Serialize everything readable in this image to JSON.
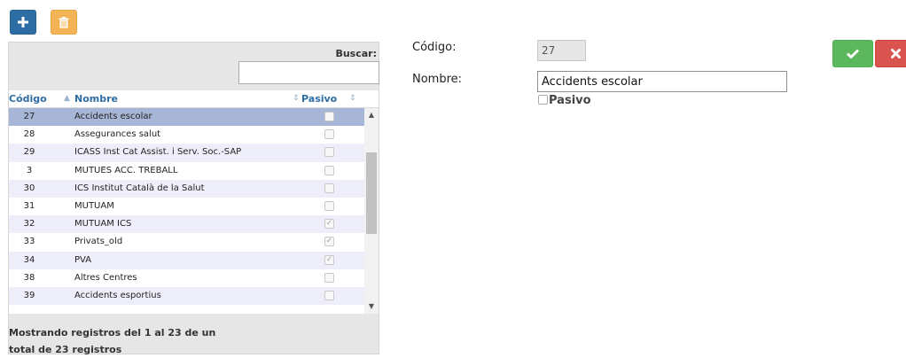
{
  "toolbar": {
    "add_icon": "plus-icon",
    "delete_icon": "trash-icon",
    "add_color": "#2e6da4",
    "delete_color": "#f4b455"
  },
  "grid": {
    "search_label": "Buscar:",
    "search_value": "",
    "columns": [
      "Código",
      "Nombre",
      "Pasivo"
    ],
    "rows": [
      {
        "code": "27",
        "name": "Accidents escolar",
        "pasivo": false,
        "selected": true
      },
      {
        "code": "28",
        "name": "Assegurances salut",
        "pasivo": false
      },
      {
        "code": "29",
        "name": "ICASS Inst Cat Assist. i Serv. Soc.-SAP",
        "pasivo": false
      },
      {
        "code": "3",
        "name": "MUTUES ACC. TREBALL",
        "pasivo": false
      },
      {
        "code": "30",
        "name": "ICS Institut Català de la Salut",
        "pasivo": false
      },
      {
        "code": "31",
        "name": "MUTUAM",
        "pasivo": false
      },
      {
        "code": "32",
        "name": "MUTUAM ICS",
        "pasivo": true
      },
      {
        "code": "33",
        "name": "Privats_old",
        "pasivo": true
      },
      {
        "code": "34",
        "name": "PVA",
        "pasivo": true
      },
      {
        "code": "38",
        "name": "Altres Centres",
        "pasivo": false
      },
      {
        "code": "39",
        "name": "Accidents esportius",
        "pasivo": false
      }
    ],
    "info_line1": "Mostrando registros del 1 al 23 de un",
    "info_line2": "total de 23 registros"
  },
  "form": {
    "code_label": "Código:",
    "code_value": "27",
    "name_label": "Nombre:",
    "name_value": "Accidents escolar",
    "pasivo_label": "Pasivo",
    "pasivo_checked": false,
    "ok_icon": "check-icon",
    "cancel_icon": "close-icon",
    "ok_color": "#5cb85c",
    "cancel_color": "#d9534f"
  }
}
